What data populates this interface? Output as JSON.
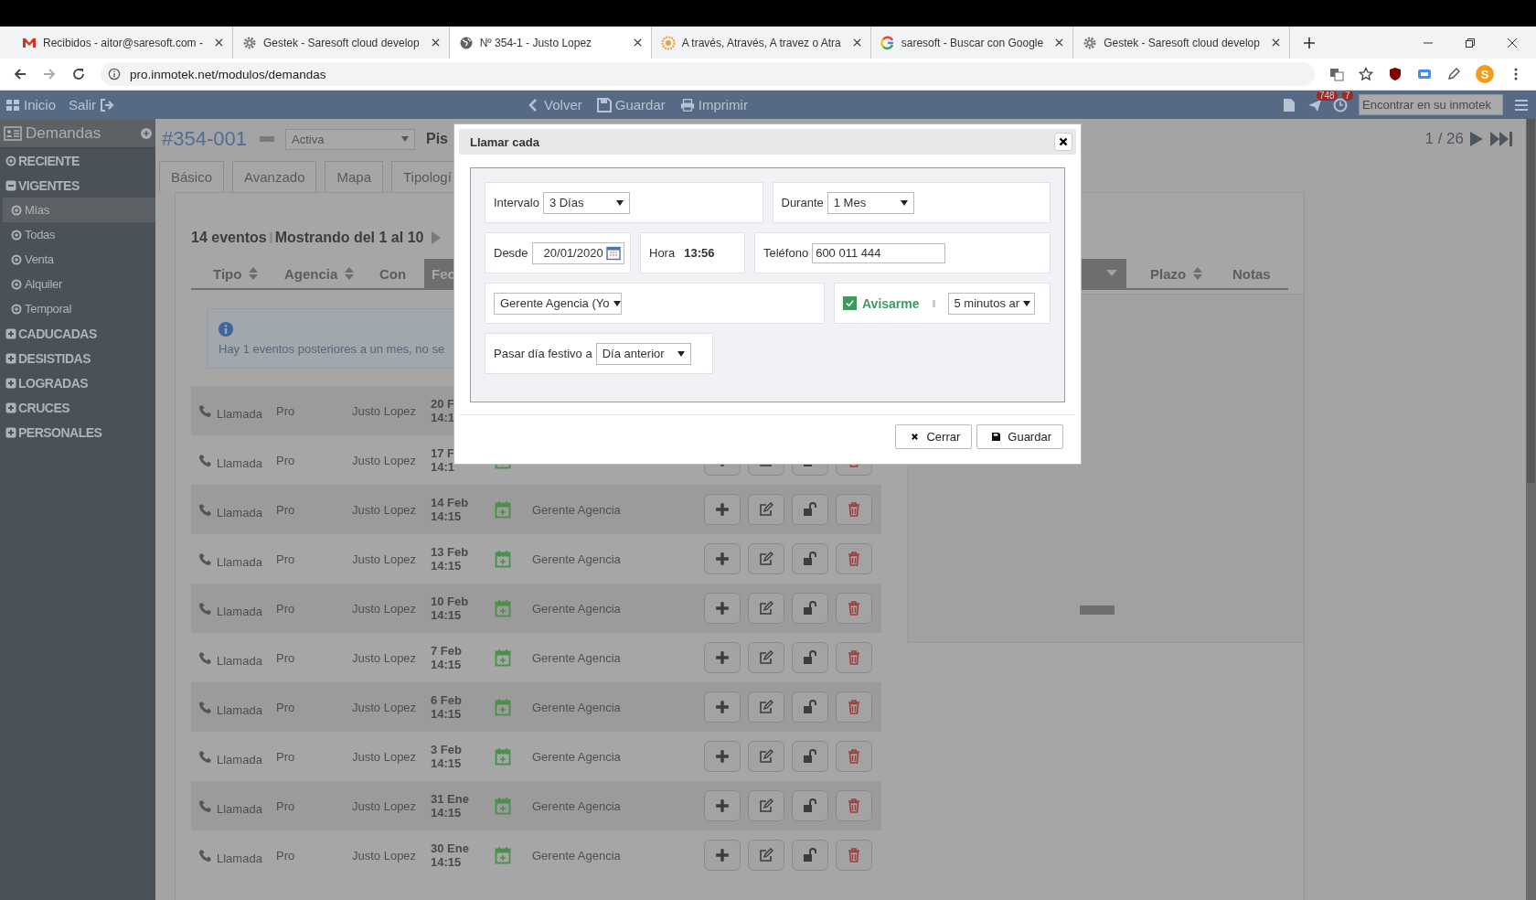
{
  "browser": {
    "tabs": [
      {
        "title": "Recibidos - aitor@saresoft.com -",
        "selected": false
      },
      {
        "title": "Gestek - Saresoft cloud develop",
        "selected": false
      },
      {
        "title": "Nº 354-1 - Justo Lopez",
        "selected": true
      },
      {
        "title": "A través, Através, A travez o Atra",
        "selected": false
      },
      {
        "title": "saresoft - Buscar con Google",
        "selected": false
      },
      {
        "title": "Gestek - Saresoft cloud develop",
        "selected": false
      }
    ],
    "address": "pro.inmotek.net/modulos/demandas",
    "profile_initial": "S"
  },
  "app_bar": {
    "left": [
      "Inicio",
      "Salir"
    ],
    "center": [
      "Volver",
      "Guardar",
      "Imprimir"
    ],
    "badges": [
      "748",
      "7"
    ],
    "search_placeholder": "Encontrar en su inmotek"
  },
  "sidebar": {
    "title": "Demandas",
    "items": [
      {
        "label": "RECIENTE",
        "kind": "link"
      },
      {
        "label": "VIGENTES",
        "kind": "group",
        "expanded": true,
        "children": [
          {
            "label": "Mías",
            "selected": true
          },
          {
            "label": "Todas",
            "selected": false
          },
          {
            "label": "Venta",
            "selected": false
          },
          {
            "label": "Alquiler",
            "selected": false
          },
          {
            "label": "Temporal",
            "selected": false
          }
        ]
      },
      {
        "label": "CADUCADAS",
        "kind": "group",
        "expanded": false
      },
      {
        "label": "DESISTIDAS",
        "kind": "group",
        "expanded": false
      },
      {
        "label": "LOGRADAS",
        "kind": "group",
        "expanded": false
      },
      {
        "label": "CRUCES",
        "kind": "group",
        "expanded": false
      },
      {
        "label": "PERSONALES",
        "kind": "group",
        "expanded": false
      }
    ]
  },
  "record": {
    "code": "#354-001",
    "status": "Activa",
    "title_fragment": "Pis",
    "pager": "1 / 26",
    "tabs": [
      "Básico",
      "Avanzado",
      "Mapa",
      "Tipologí"
    ]
  },
  "events": {
    "count": "14 eventos",
    "showing": "Mostrando del 1 al 10",
    "columns": [
      {
        "label": "Tipo",
        "sortable": true,
        "active": false
      },
      {
        "label": "Agencia",
        "sortable": true,
        "active": false
      },
      {
        "label": "Con",
        "sortable": false,
        "active": false
      },
      {
        "label": "Fec",
        "sortable": false,
        "active": true
      },
      {
        "label": "Plazo",
        "sortable": true,
        "active": false
      },
      {
        "label": "Notas",
        "sortable": false,
        "active": false
      }
    ],
    "info": "Hay 1 eventos posteriores a un mes, no se",
    "rows": [
      {
        "type": "Llamada",
        "agency": "Pro",
        "contact": "Justo Lopez",
        "date": "20 F",
        "time": "14:1"
      },
      {
        "type": "Llamada",
        "agency": "Pro",
        "contact": "Justo Lopez",
        "date": "17 F",
        "time": "14:1",
        "actions": true
      },
      {
        "type": "Llamada",
        "agency": "Pro",
        "contact": "Justo Lopez",
        "date": "14 Feb",
        "time": "14:15",
        "agent": "Gerente Agencia",
        "actions": true
      },
      {
        "type": "Llamada",
        "agency": "Pro",
        "contact": "Justo Lopez",
        "date": "13 Feb",
        "time": "14:15",
        "agent": "Gerente Agencia",
        "actions": true
      },
      {
        "type": "Llamada",
        "agency": "Pro",
        "contact": "Justo Lopez",
        "date": "10 Feb",
        "time": "14:15",
        "agent": "Gerente Agencia",
        "actions": true
      },
      {
        "type": "Llamada",
        "agency": "Pro",
        "contact": "Justo Lopez",
        "date": "7 Feb",
        "time": "14:15",
        "agent": "Gerente Agencia",
        "actions": true
      },
      {
        "type": "Llamada",
        "agency": "Pro",
        "contact": "Justo Lopez",
        "date": "6 Feb",
        "time": "14:15",
        "agent": "Gerente Agencia",
        "actions": true
      },
      {
        "type": "Llamada",
        "agency": "Pro",
        "contact": "Justo Lopez",
        "date": "3 Feb",
        "time": "14:15",
        "agent": "Gerente Agencia",
        "actions": true
      },
      {
        "type": "Llamada",
        "agency": "Pro",
        "contact": "Justo Lopez",
        "date": "31 Ene",
        "time": "14:15",
        "agent": "Gerente Agencia",
        "actions": true
      },
      {
        "type": "Llamada",
        "agency": "Pro",
        "contact": "Justo Lopez",
        "date": "30 Ene",
        "time": "14:15",
        "agent": "Gerente Agencia",
        "actions": true
      }
    ]
  },
  "dialog": {
    "title": "Llamar cada",
    "interval": {
      "label": "Intervalo",
      "value": "3 Días"
    },
    "duration": {
      "label": "Durante",
      "value": "1 Mes"
    },
    "from": {
      "label": "Desde",
      "value": "20/01/2020"
    },
    "time": {
      "label": "Hora",
      "value": "13:56"
    },
    "phone": {
      "label": "Teléfono",
      "value": "600 011 444"
    },
    "assignee": {
      "value": "Gerente Agencia (Yo"
    },
    "notify": {
      "label": "Avisarme",
      "checked": true,
      "value": "5 minutos ar"
    },
    "holiday": {
      "label": "Pasar día festivo a",
      "value": "Día anterior"
    },
    "buttons": [
      {
        "label": "Cerrar",
        "kind": "close"
      },
      {
        "label": "Guardar",
        "kind": "save"
      }
    ]
  }
}
